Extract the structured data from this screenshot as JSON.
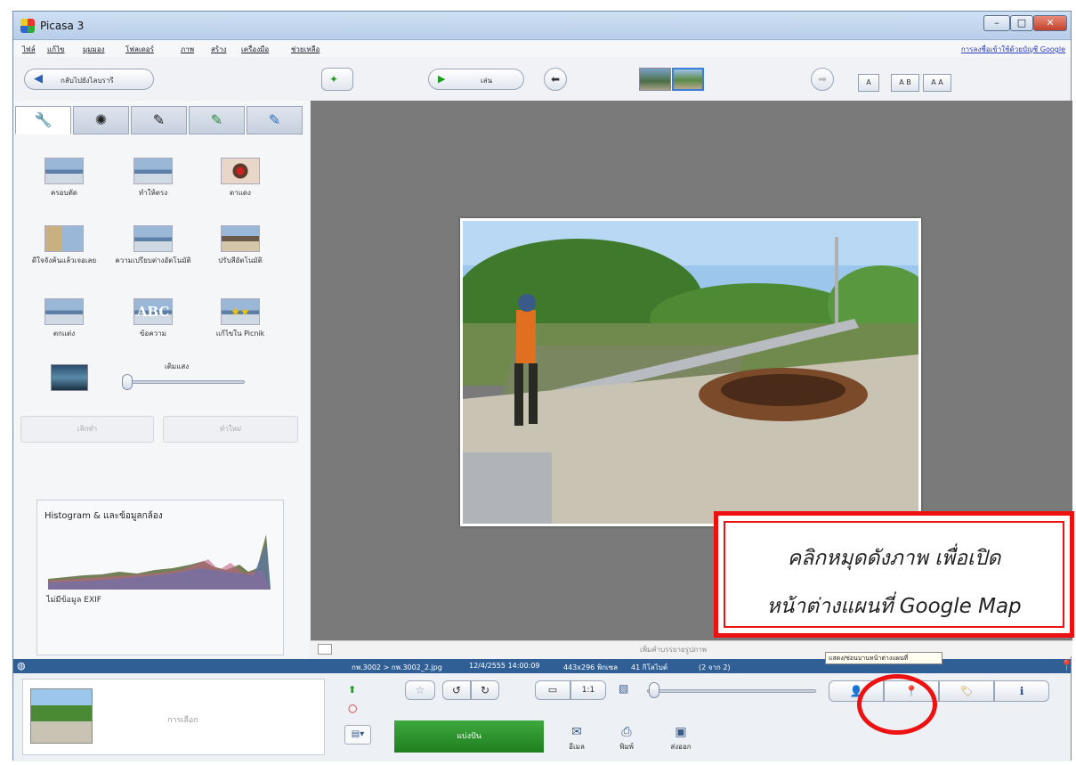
{
  "window": {
    "title": "Picasa 3"
  },
  "menu": {
    "items": [
      "ไฟล์",
      "แก้ไข",
      "มุมมอง",
      "โฟลเดอร์",
      "ภาพ",
      "สร้าง",
      "เครื่องมือ",
      "ช่วยเหลือ"
    ],
    "signin": "การลงชื่อเข้าใช้ด้วยบัญชี Google"
  },
  "toolbar": {
    "back_label": "กลับไปยังไลบรารี",
    "play_label": "เล่น",
    "caption_buttons": [
      "A",
      "A B",
      "A A"
    ]
  },
  "tabs": [
    "wrench-icon",
    "sun-icon",
    "brush-icon",
    "brush-green-icon",
    "brush-blue-icon"
  ],
  "tools": {
    "row1": [
      "ครอบตัด",
      "ทำให้ตรง",
      "ตาแดง"
    ],
    "row2": [
      "ดีใจจังค้นแล้วเจอเลย",
      "ความเปรียบต่างอัตโนมัติ",
      "ปรับสีอัตโนมัติ"
    ],
    "row3": [
      "ตกแต่ง",
      "ข้อความ",
      "แก้ไขใน Picnik"
    ],
    "fill_light_label": "เติมแสง",
    "fill_light_level": 0.0,
    "undo_label": "เลิกทำ",
    "redo_label": "ทำใหม่"
  },
  "histogram": {
    "title": "Histogram & และข้อมูลกล้อง",
    "exif": "ไม่มีข้อมูล EXIF"
  },
  "caption": {
    "placeholder": "เพิ่มคำบรรยายรูปภาพ"
  },
  "infobar": {
    "path": "กพ.3002 > กพ.3002_2.jpg",
    "date": "12/4/2555 14:00:09",
    "dimensions": "443x296 พิกเซล",
    "size": "41 กิโลไบต์",
    "count": "(2 จาก 2)"
  },
  "tooltip": {
    "text": "แสดง/ซ่อนบานหน้าต่างแผนที่"
  },
  "bottom": {
    "selection_label": "การเลือก",
    "share_label": "แบ่งปัน",
    "email_label": "อีเมล",
    "print_label": "พิมพ์",
    "export_label": "ส่งออก"
  },
  "callout": {
    "line1": "คลิกหมุดดังภาพ เพื่อเปิด",
    "line2": "หน้าต่างแผนที่ Google Map"
  },
  "colors": {
    "accent_red": "#ee1111",
    "share_green": "#2a952a",
    "infobar_blue": "#2f5f95"
  }
}
